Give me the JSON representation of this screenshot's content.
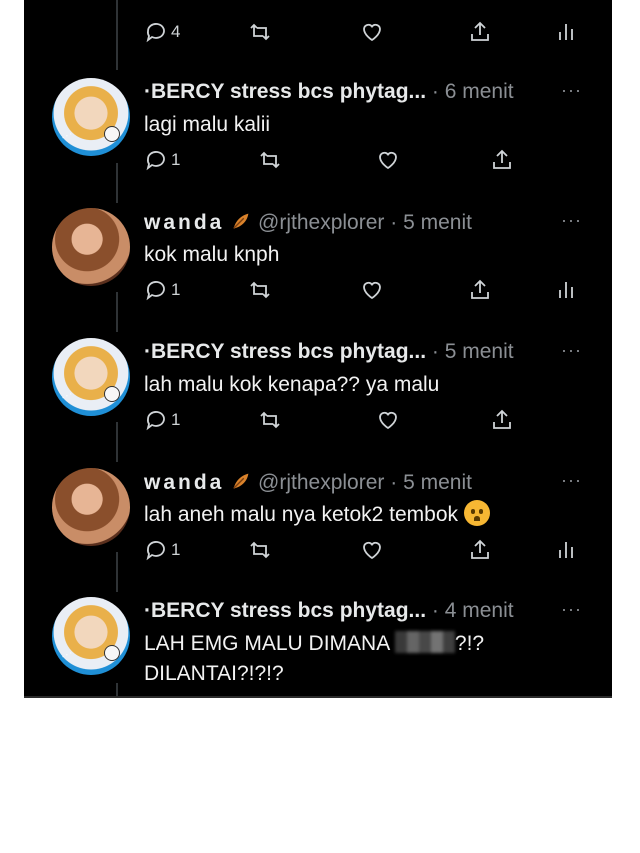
{
  "top_tweet": {
    "reply_count": "4",
    "cropped_text": "..."
  },
  "tweets": [
    {
      "display_name": "·BERCY stress bcs phytag...",
      "handle": "",
      "time": "· 6 menit",
      "text": "lagi malu kalii",
      "reply_count": "1"
    },
    {
      "display_name": "wanda",
      "handle": "@rjthexplorer",
      "time": "· 5 menit",
      "text": "kok malu knph",
      "reply_count": "1"
    },
    {
      "display_name": "·BERCY stress bcs phytag...",
      "handle": "",
      "time": "· 5 menit",
      "text": "lah malu kok kenapa?? ya malu",
      "reply_count": "1"
    },
    {
      "display_name": "wanda",
      "handle": "@rjthexplorer",
      "time": "· 5 menit",
      "text": "lah aneh malu nya ketok2 tembok",
      "reply_count": "1"
    },
    {
      "display_name": "·BERCY stress bcs phytag...",
      "handle": "",
      "time": "· 4 menit",
      "text_before_censor": "LAH EMG MALU DIMANA",
      "text_after_censor": "?!?",
      "text_line2": "DILANTAI?!?!?"
    }
  ],
  "more_label": "···",
  "colors": {
    "background": "#000000",
    "text": "#f2f2f2",
    "muted": "#8b8f94",
    "divider": "#2f3336"
  }
}
